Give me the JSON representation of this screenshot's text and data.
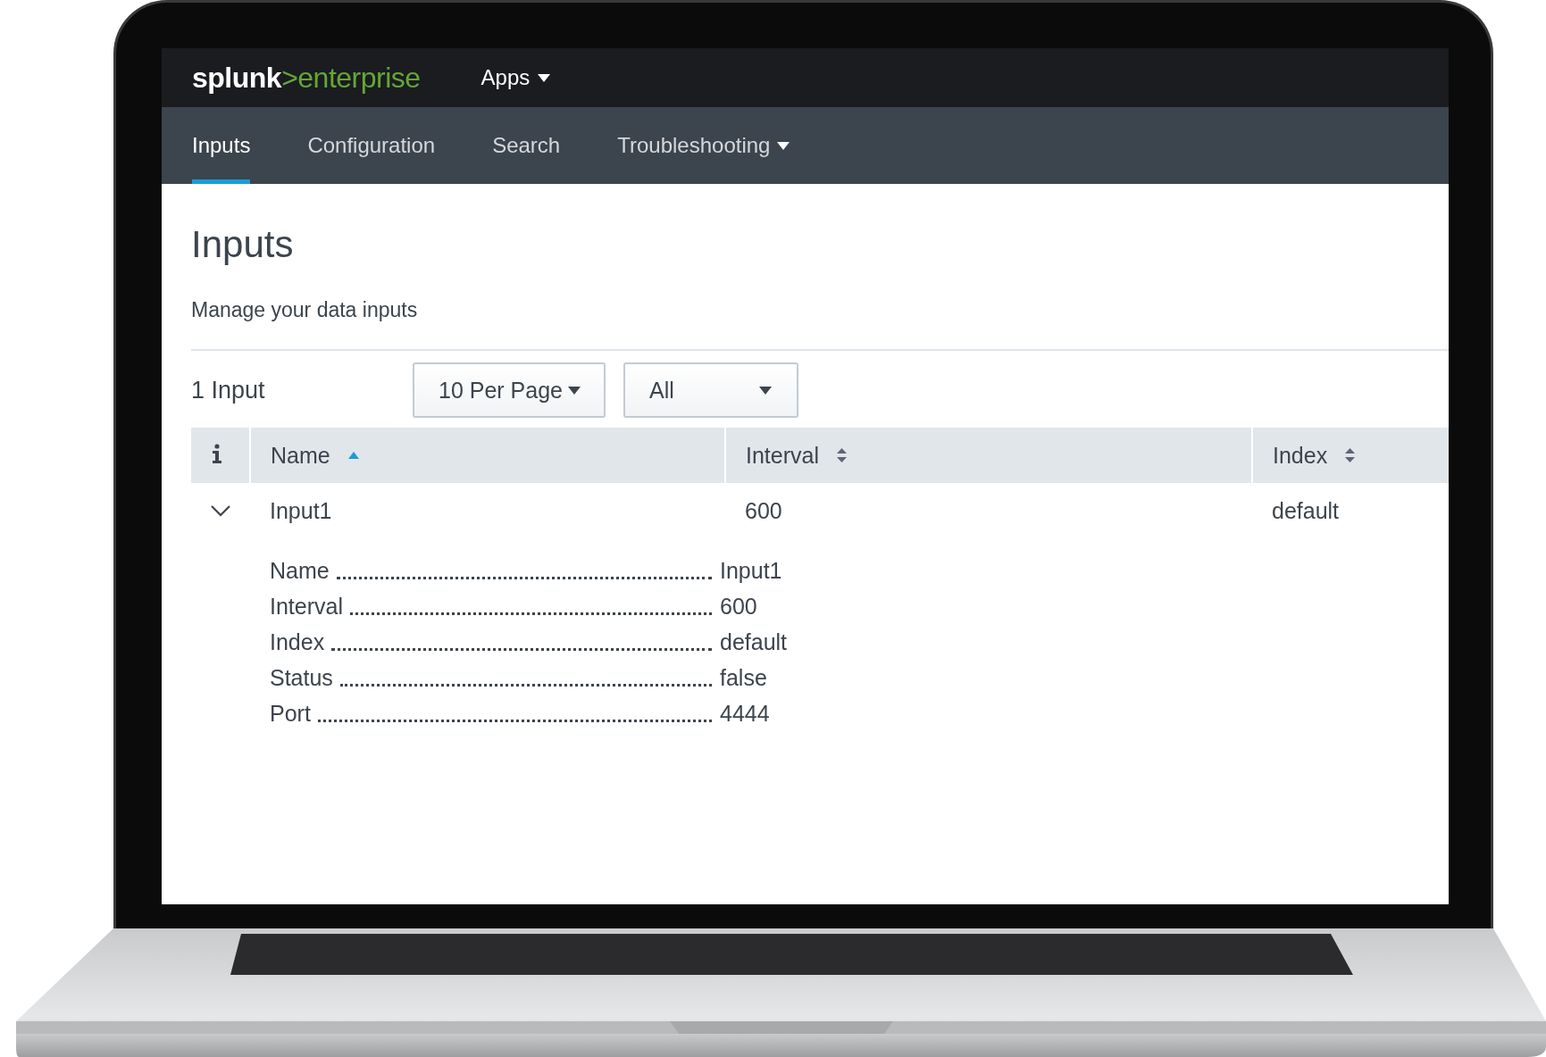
{
  "brand": {
    "name": "splunk",
    "separator": ">",
    "product": "enterprise"
  },
  "top_menu": [
    {
      "label": "Apps",
      "has_menu": true
    }
  ],
  "nav": {
    "tabs": [
      {
        "label": "Inputs",
        "selected": true,
        "has_menu": false
      },
      {
        "label": "Configuration",
        "selected": false,
        "has_menu": false
      },
      {
        "label": "Search",
        "selected": false,
        "has_menu": false
      },
      {
        "label": "Troubleshooting",
        "selected": false,
        "has_menu": true
      }
    ]
  },
  "page": {
    "title": "Inputs",
    "subtitle": "Manage your data inputs"
  },
  "toolbar": {
    "count": "1 Input",
    "page_size": "10 Per Page",
    "filter": "All"
  },
  "table": {
    "columns": [
      {
        "label": "Name",
        "sorted": true,
        "ascending": true
      },
      {
        "label": "Interval",
        "sorted": false
      },
      {
        "label": "Index",
        "sorted": false
      }
    ],
    "rows": [
      {
        "cells": [
          "Input1",
          "600",
          "default"
        ],
        "expanded": true,
        "details": [
          {
            "label": "Name",
            "value": "Input1"
          },
          {
            "label": "Interval",
            "value": "600"
          },
          {
            "label": "Index",
            "value": "default"
          },
          {
            "label": "Status",
            "value": "false"
          },
          {
            "label": "Port",
            "value": "4444"
          }
        ]
      }
    ]
  }
}
